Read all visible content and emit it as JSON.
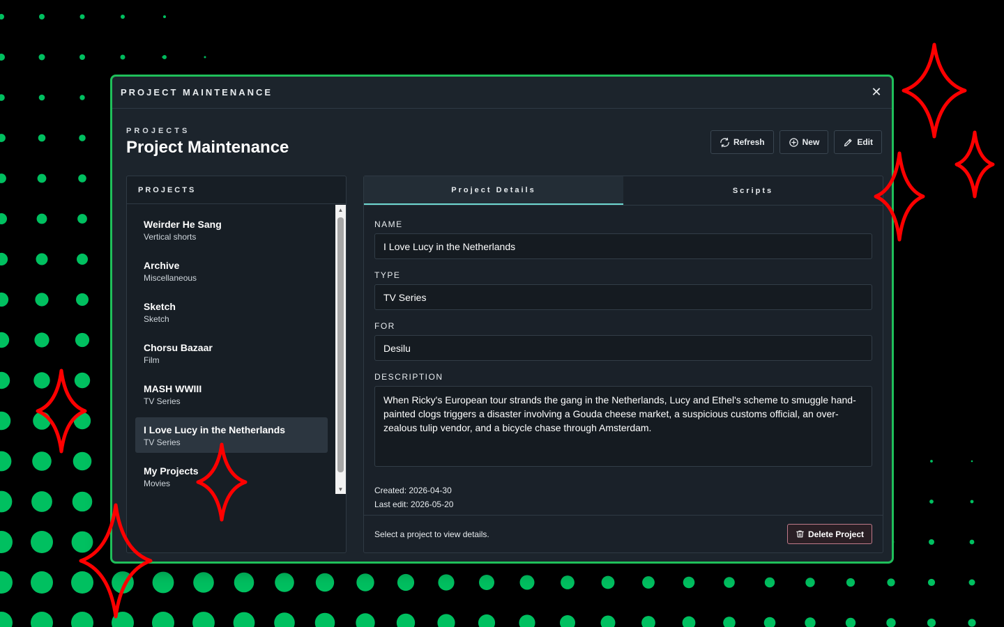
{
  "window": {
    "title": "PROJECT MAINTENANCE",
    "close_glyph": "✕"
  },
  "header": {
    "eyebrow": "PROJECTS",
    "title": "Project Maintenance"
  },
  "toolbar": {
    "refresh_label": "Refresh",
    "new_label": "New",
    "edit_label": "Edit"
  },
  "sidebar": {
    "heading": "PROJECTS",
    "items": [
      {
        "name": "Weirder He Sang",
        "type": "Vertical shorts"
      },
      {
        "name": "Archive",
        "type": "Miscellaneous"
      },
      {
        "name": "Sketch",
        "type": "Sketch"
      },
      {
        "name": "Chorsu Bazaar",
        "type": "Film"
      },
      {
        "name": "MASH WWIII",
        "type": "TV Series"
      },
      {
        "name": "I Love Lucy in the Netherlands",
        "type": "TV Series"
      },
      {
        "name": "My Projects",
        "type": "Movies"
      }
    ],
    "selected_index": 5
  },
  "tabs": [
    {
      "label": "Project Details",
      "active": true
    },
    {
      "label": "Scripts",
      "active": false
    }
  ],
  "details": {
    "name_label": "NAME",
    "name_value": "I Love Lucy in the Netherlands",
    "type_label": "TYPE",
    "type_value": "TV Series",
    "for_label": "FOR",
    "for_value": "Desilu",
    "description_label": "DESCRIPTION",
    "description_value": "When Ricky's European tour strands the gang in the Netherlands, Lucy and Ethel's scheme to smuggle hand-painted clogs triggers a disaster involving a Gouda cheese market, a suspicious customs official, an over-zealous tulip vendor, and a bicycle chase through Amsterdam.",
    "created": "Created: 2026-04-30",
    "last_edit": "Last edit: 2026-05-20"
  },
  "footer": {
    "status": "Select a project to view details.",
    "delete_label": "Delete Project"
  },
  "colors": {
    "accent_green": "#1fbf5a",
    "dots_green": "#00c060",
    "tab_underline": "#6fd7d0",
    "sparkle_red": "#ff0000",
    "danger_border": "#c07a8a"
  }
}
